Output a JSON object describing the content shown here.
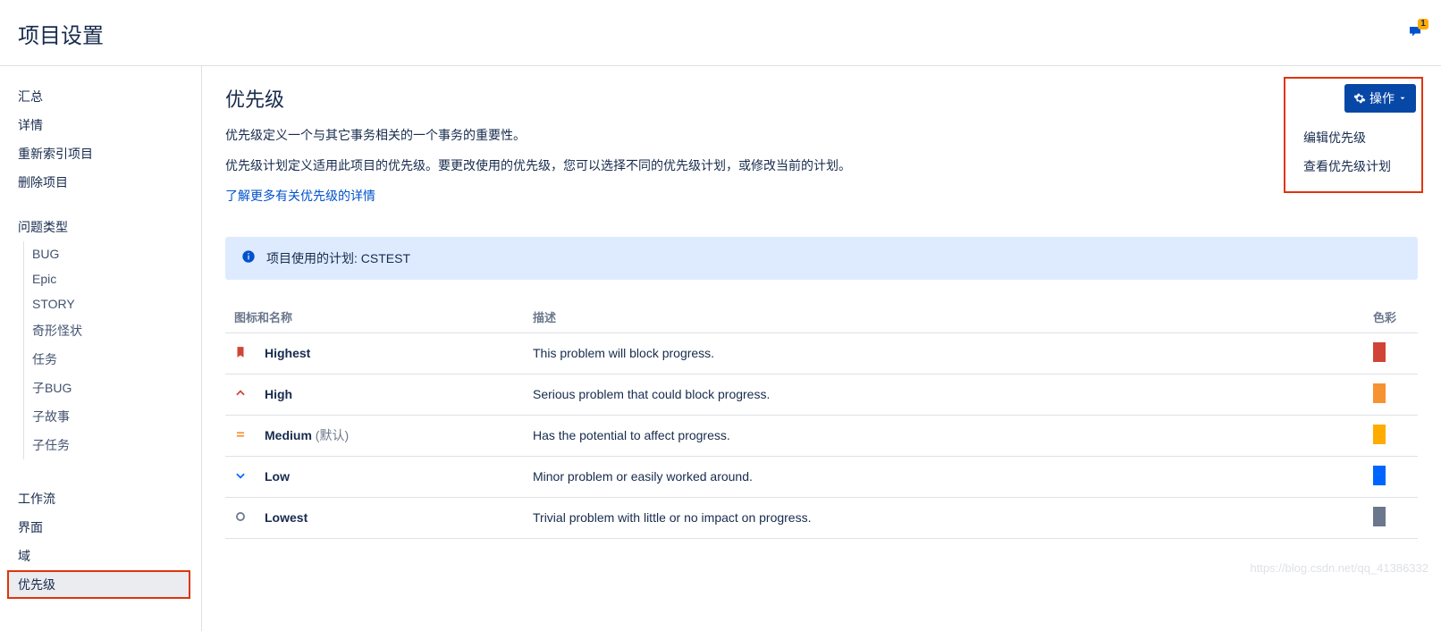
{
  "header": {
    "title": "项目设置"
  },
  "notification": {
    "badge": "1"
  },
  "sidebar": {
    "items1": [
      {
        "label": "汇总"
      },
      {
        "label": "详情"
      },
      {
        "label": "重新索引项目"
      },
      {
        "label": "删除项目"
      }
    ],
    "issueTypes": {
      "header": "问题类型",
      "items": [
        {
          "label": "BUG"
        },
        {
          "label": "Epic"
        },
        {
          "label": "STORY"
        },
        {
          "label": "奇形怪状"
        },
        {
          "label": "任务"
        },
        {
          "label": "子BUG"
        },
        {
          "label": "子故事"
        },
        {
          "label": "子任务"
        }
      ]
    },
    "items2": [
      {
        "label": "工作流"
      },
      {
        "label": "界面"
      },
      {
        "label": "域"
      },
      {
        "label": "优先级",
        "selected": true
      }
    ]
  },
  "main": {
    "title": "优先级",
    "desc1": "优先级定义一个与其它事务相关的一个事务的重要性。",
    "desc2": "优先级计划定义适用此项目的优先级。要更改使用的优先级，您可以选择不同的优先级计划，或修改当前的计划。",
    "learnMore": "了解更多有关优先级的详情",
    "infoBanner": "项目使用的计划: CSTEST"
  },
  "actions": {
    "button": "操作",
    "items": [
      {
        "label": "编辑优先级"
      },
      {
        "label": "查看优先级计划"
      }
    ]
  },
  "table": {
    "headers": {
      "iconName": "图标和名称",
      "description": "描述",
      "color": "色彩"
    },
    "rows": [
      {
        "name": "Highest",
        "default": "",
        "desc": "This problem will block progress.",
        "color": "#d04437",
        "iconColor": "#d04437",
        "iconType": "bookmark"
      },
      {
        "name": "High",
        "default": "",
        "desc": "Serious problem that could block progress.",
        "color": "#f79232",
        "iconColor": "#d04437",
        "iconType": "up"
      },
      {
        "name": "Medium",
        "default": " (默认)",
        "desc": "Has the potential to affect progress.",
        "color": "#ffab00",
        "iconColor": "#f79232",
        "iconType": "equal"
      },
      {
        "name": "Low",
        "default": "",
        "desc": "Minor problem or easily worked around.",
        "color": "#0065ff",
        "iconColor": "#0065ff",
        "iconType": "down"
      },
      {
        "name": "Lowest",
        "default": "",
        "desc": "Trivial problem with little or no impact on progress.",
        "color": "#6b778c",
        "iconColor": "#6b778c",
        "iconType": "circle"
      }
    ]
  },
  "watermark": "https://blog.csdn.net/qq_41386332"
}
